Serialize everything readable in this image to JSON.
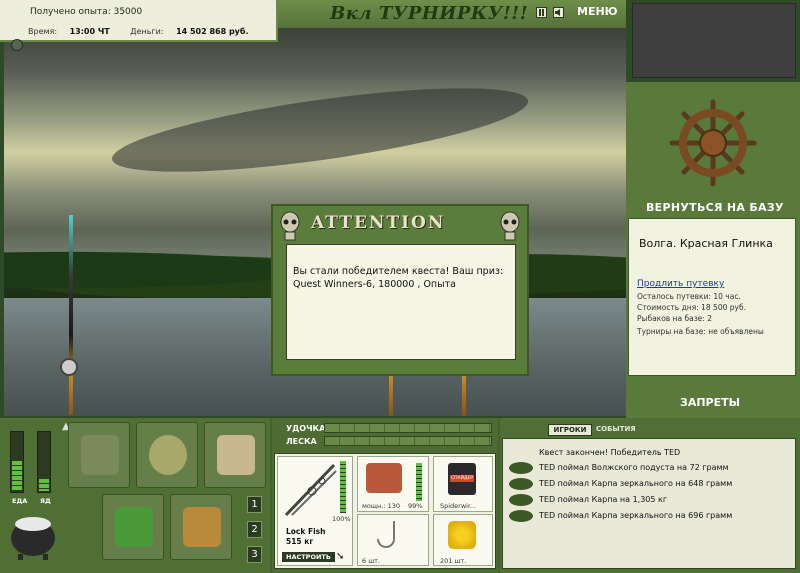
{
  "info": {
    "exp_label": "Получено опыта: 35000",
    "time_label": "Время:",
    "time_value": "13:00 ЧТ",
    "money_label": "Деньги:",
    "money_value": "14 502 868 руб."
  },
  "topbar": {
    "tournament_text": "Вкл ТУРНИРКУ!!!",
    "menu_label": "МЕНЮ"
  },
  "right": {
    "return_label": "ВЕРНУТЬСЯ НА БАЗУ",
    "base_name": "Волга. Красная Глинка",
    "extend_link": "Продлить путевку",
    "lines": [
      "Осталось путевки: 10 час.",
      "Стоимость дня: 18 500 руб.",
      "Рыбаков на базе: 2",
      "Турниры на базе: не объявлены"
    ],
    "bans_label": "ЗАПРЕТЫ"
  },
  "dialog": {
    "title": "ATTENTION",
    "message": "Вы стали победителем квеста! Ваш приз: Quest Winners-6, 180000 , Опыта"
  },
  "left_panel": {
    "food_label": "ЕДА",
    "poison_label": "ЯД",
    "pages": [
      "1",
      "2",
      "3"
    ]
  },
  "tackle": {
    "rod_label": "УДОЧКА",
    "line_label": "ЛЕСКА",
    "rod_name": "Lock Fish",
    "rod_weight": "515 кг",
    "rod_percent": "100%",
    "setup_label": "НАСТРОИТЬ",
    "reel_power": "мощн.: 130",
    "reel_percent": "99%",
    "line_name": "Spiderwir...",
    "bait_label": "СПАЙДЕР",
    "hook_count": "6 шт.",
    "corn_count": "201 шт."
  },
  "events": {
    "tab_players": "ИГРОКИ",
    "tab_events": "СОБЫТИЯ",
    "quest_done": "Квест закончен! Победитель TED",
    "catches": [
      "TED поймал Волжского подуста на 72 грамм",
      "TED поймал Карпа зеркального на 648 грамм",
      "TED поймал Карпа на 1,305 кг",
      "TED поймал Карпа зеркального на 696 грамм"
    ]
  }
}
